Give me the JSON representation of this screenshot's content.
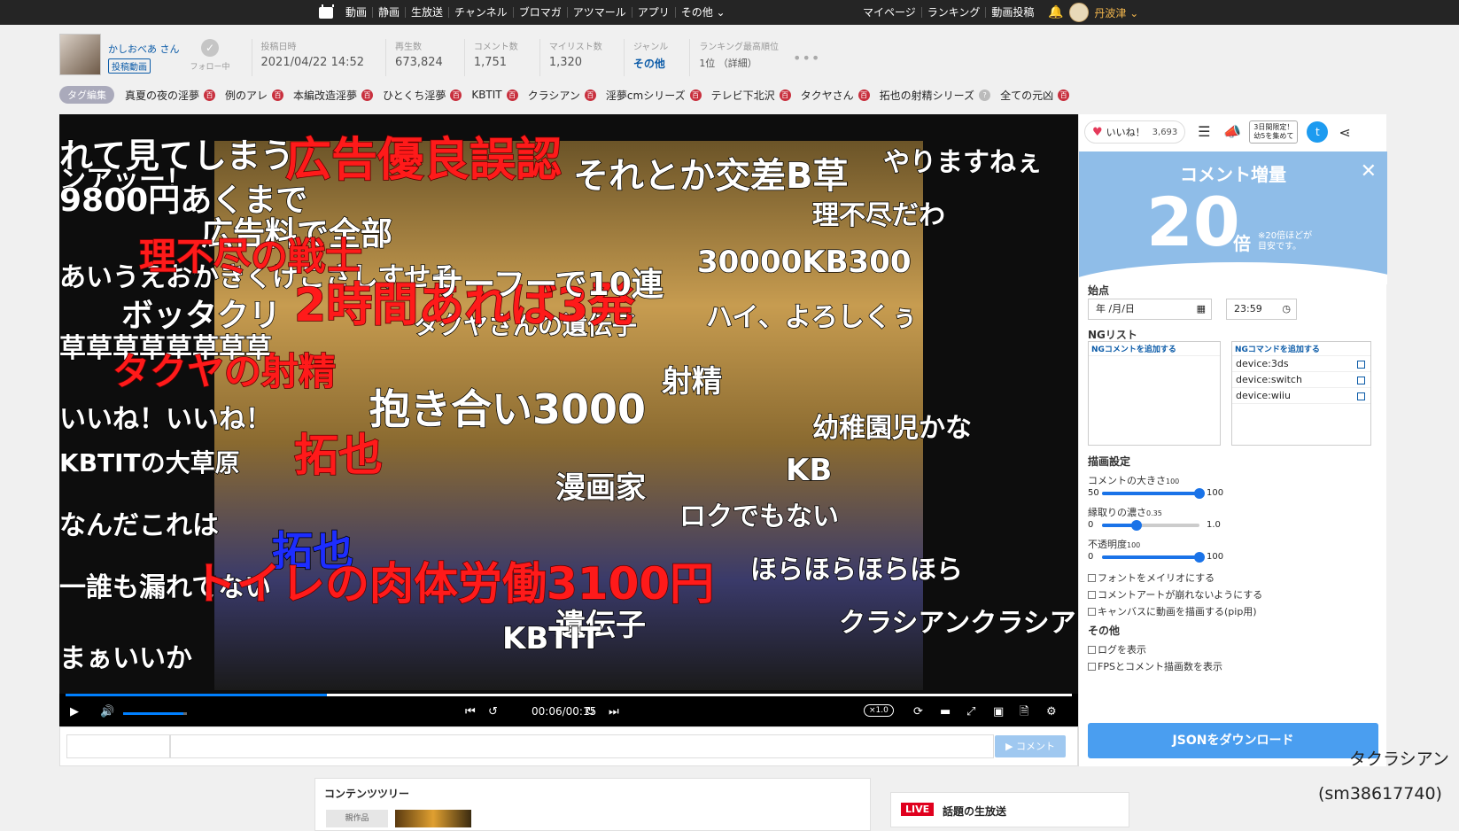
{
  "topbar": {
    "nav": [
      "動画",
      "静画",
      "生放送",
      "チャンネル",
      "ブロマガ",
      "アツマール",
      "アプリ",
      "その他 ⌄"
    ],
    "right": [
      "マイページ",
      "ランキング",
      "動画投稿"
    ],
    "user_name": "丹波津 ⌄"
  },
  "video_info": {
    "uploader": "かしおべあ さん",
    "uploader_badge": "投稿動画",
    "follow_label": "フォロー中",
    "posted_label": "投稿日時",
    "posted_value": "2021/04/22 14:52",
    "views_label": "再生数",
    "views_value": "673,824",
    "comments_label": "コメント数",
    "comments_value": "1,751",
    "mylist_label": "マイリスト数",
    "mylist_value": "1,320",
    "genre_label": "ジャンル",
    "genre_value": "その他",
    "ranking_label": "ランキング最高順位",
    "ranking_value": "1位 （詳細）"
  },
  "tags": {
    "edit_label": "タグ編集",
    "items": [
      {
        "name": "真夏の夜の淫夢",
        "dic": "百"
      },
      {
        "name": "例のアレ",
        "dic": "百"
      },
      {
        "name": "本編改造淫夢",
        "dic": "百"
      },
      {
        "name": "ひとくち淫夢",
        "dic": "百"
      },
      {
        "name": "KBTIT",
        "dic": "百"
      },
      {
        "name": "クラシアン",
        "dic": "百"
      },
      {
        "name": "淫夢cmシリーズ",
        "dic": "百"
      },
      {
        "name": "テレビ下北沢",
        "dic": "百"
      },
      {
        "name": "タクヤさん",
        "dic": "百"
      },
      {
        "name": "拓也の射精シリーズ",
        "dic": "?"
      },
      {
        "name": "全ての元凶",
        "dic": "百"
      }
    ]
  },
  "player": {
    "time": "00:06/00:15",
    "speed": "×1.0",
    "progress": 0.26,
    "volume": 0.95,
    "comments": [
      {
        "text": "れて見てしまう",
        "color": "w"
      },
      {
        "text": "広告優良誤認",
        "color": "r"
      },
      {
        "text": "それとか交差B草",
        "color": "w"
      },
      {
        "text": "9800円あくまで",
        "color": "w"
      },
      {
        "text": "広告料で全部",
        "color": "w"
      },
      {
        "text": "理不尽の戦士",
        "color": "r"
      },
      {
        "text": "2時間あれば3発",
        "color": "r"
      },
      {
        "text": "サーフーで10連",
        "color": "w"
      },
      {
        "text": "30000KB300",
        "color": "w"
      },
      {
        "text": "ボッタクリ",
        "color": "w"
      },
      {
        "text": "タクヤの射精",
        "color": "r"
      },
      {
        "text": "抱き合い3000",
        "color": "w"
      },
      {
        "text": "射精",
        "color": "w"
      },
      {
        "text": "拓也",
        "color": "r"
      },
      {
        "text": "KB",
        "color": "w"
      },
      {
        "text": "漫画家",
        "color": "w"
      },
      {
        "text": "拓也",
        "color": "b"
      },
      {
        "text": "トイレの肉体労働3100円",
        "color": "r"
      },
      {
        "text": "遺伝子",
        "color": "w"
      },
      {
        "text": "KBTIT",
        "color": "w"
      }
    ]
  },
  "comment_bar": {
    "send_label": "▶ コメント"
  },
  "panel": {
    "like_label": "いいね！",
    "like_count": "3,693",
    "limited_label": "3日間限定！\n幼5を集めて",
    "boost_title": "コメント増量",
    "boost_num": "20",
    "boost_unit": "倍",
    "boost_note1": "※20倍ほどが",
    "boost_note2": "目安です。",
    "start_label": "始点",
    "date_value": "年 /月/日",
    "time_value": "23:59",
    "ng_label": "NGリスト",
    "ng_comment_header": "NGコメントを追加する",
    "ng_command_header": "NGコマンドを追加する",
    "ng_commands": [
      "device:3ds",
      "device:switch",
      "device:wiiu"
    ],
    "draw_label": "描画設定",
    "size_label": "コメントの大きさ",
    "size_value": "100",
    "size_min": "50",
    "size_max": "100",
    "size_fill": 1.0,
    "edge_label": "縁取りの濃さ",
    "edge_value": "0.35",
    "edge_min": "0",
    "edge_max": "1.0",
    "edge_fill": 0.35,
    "opacity_label": "不透明度",
    "opacity_value": "100",
    "opacity_min": "0",
    "opacity_max": "100",
    "opacity_fill": 1.0,
    "chk_meiryo": "フォントをメイリオにする",
    "chk_art": "コメントアートが崩れないようにする",
    "chk_pip": "キャンバスに動画を描画する(pip用)",
    "other_label": "その他",
    "chk_log": "ログを表示",
    "chk_fps": "FPSとコメント描画数を表示",
    "download_label": "JSONをダウンロード"
  },
  "below": {
    "tree_title": "コンテンツツリー",
    "tree_thumb_label": "親作品",
    "live_badge": "LIVE",
    "live_title": "話題の生放送"
  },
  "caption": {
    "line1": "タクラシアン",
    "line2": "(sm38617740)"
  }
}
